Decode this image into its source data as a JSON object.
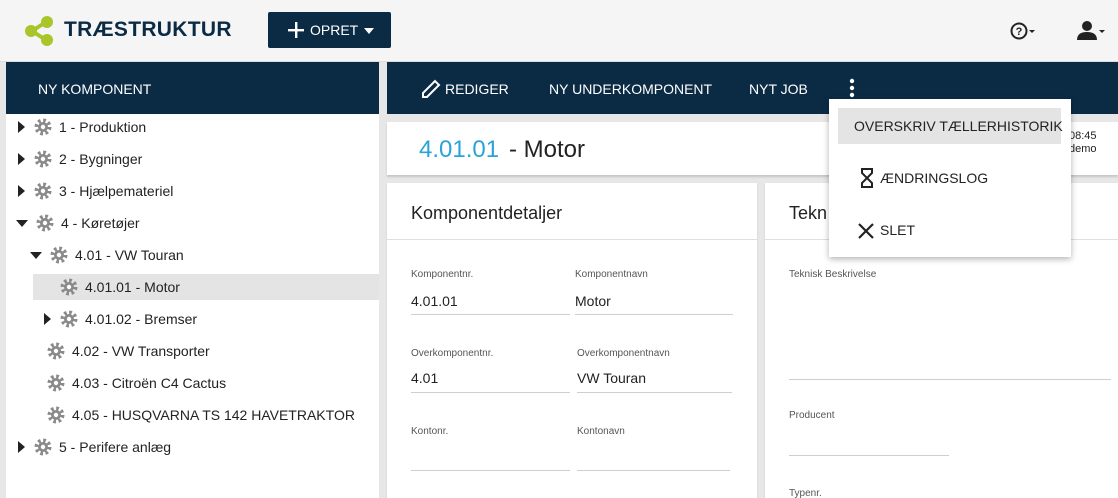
{
  "app": {
    "title": "TRÆSTRUKTUR",
    "create_label": "OPRET",
    "brand_color": "#0b2b45",
    "logo_color": "#a8c62a"
  },
  "left_panel": {
    "header_label": "NY KOMPONENT",
    "tree": [
      {
        "label": "1 - Produktion",
        "expander": "collapsed",
        "level": 0
      },
      {
        "label": "2 - Bygninger",
        "expander": "collapsed",
        "level": 0
      },
      {
        "label": "3 - Hjælpemateriel",
        "expander": "collapsed",
        "level": 0
      },
      {
        "label": "4 - Køretøjer",
        "expander": "expanded",
        "level": 0
      },
      {
        "label": "4.01 - VW Touran",
        "expander": "expanded",
        "level": 1
      },
      {
        "label": "4.01.01 - Motor",
        "expander": "none",
        "level": 2,
        "selected": true
      },
      {
        "label": "4.01.02 - Bremser",
        "expander": "collapsed",
        "level": 2
      },
      {
        "label": "4.02 - VW Transporter",
        "expander": "none",
        "level": 1
      },
      {
        "label": "4.03 - Citroën C4 Cactus",
        "expander": "none",
        "level": 1
      },
      {
        "label": "4.05 - HUSQVARNA TS 142 HAVETRAKTOR",
        "expander": "none",
        "level": 1
      },
      {
        "label": "5 - Perifere anlæg",
        "expander": "collapsed",
        "level": 0
      }
    ]
  },
  "toolbar": {
    "edit_label": "REDIGER",
    "new_sub_label": "NY UNDERKOMPONENT",
    "new_job_label": "NYT JOB"
  },
  "component": {
    "id": "4.01.01",
    "name_suffix": "- Motor",
    "meta_time": "08:45",
    "meta_user": "demo",
    "id_color": "#2aa3d8"
  },
  "details_card": {
    "title": "Komponentdetaljer",
    "fields": {
      "komponentnr_label": "Komponentnr.",
      "komponentnr_value": "4.01.01",
      "komponentnavn_label": "Komponentnavn",
      "komponentnavn_value": "Motor",
      "overkomponentnr_label": "Overkomponentnr.",
      "overkomponentnr_value": "4.01",
      "overkomponentnavn_label": "Overkomponentnavn",
      "overkomponentnavn_value": "VW Touran",
      "kontonr_label": "Kontonr.",
      "kontonr_value": "",
      "kontonavn_label": "Kontonavn",
      "kontonavn_value": ""
    }
  },
  "tech_card": {
    "title_visible": "Tekn",
    "beskrivelse_label": "Teknisk Beskrivelse",
    "producent_label": "Producent",
    "typenr_label": "Typenr."
  },
  "menu": {
    "items": [
      {
        "label": "OVERSKRIV TÆLLERHISTORIK",
        "icon": "none"
      },
      {
        "label": "ÆNDRINGSLOG",
        "icon": "hourglass-icon"
      },
      {
        "label": "SLET",
        "icon": "close-icon"
      }
    ]
  }
}
